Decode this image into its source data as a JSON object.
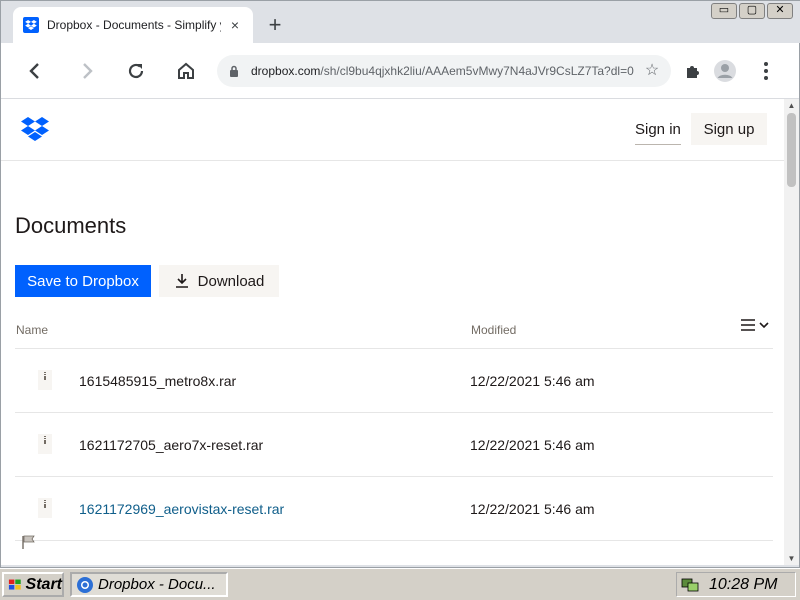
{
  "browser": {
    "tab_title": "Dropbox - Documents - Simplify your",
    "new_tab_symbol": "+",
    "tab_close_symbol": "×",
    "url_host": "dropbox.com",
    "url_path": "/sh/cl9bu4qjxhk2liu/AAAem5vMwy7N4aJVr9CsLZ7Ta?dl=0",
    "window_controls": [
      "▭",
      "▢",
      "✕"
    ]
  },
  "site": {
    "signin_label": "Sign in",
    "signup_label": "Sign up",
    "brand_color": "#0061fe"
  },
  "folder": {
    "title": "Documents",
    "save_label": "Save to Dropbox",
    "download_label": "Download",
    "columns": {
      "name": "Name",
      "modified": "Modified"
    },
    "files": [
      {
        "name": "1615485915_metro8x.rar",
        "modified": "12/22/2021 5:46 am"
      },
      {
        "name": "1621172705_aero7x-reset.rar",
        "modified": "12/22/2021 5:46 am"
      },
      {
        "name": "1621172969_aerovistax-reset.rar",
        "modified": "12/22/2021 5:46 am"
      }
    ]
  },
  "taskbar": {
    "start_label": "Start",
    "task_label": "Dropbox - Docu...",
    "clock": "10:28 PM"
  }
}
